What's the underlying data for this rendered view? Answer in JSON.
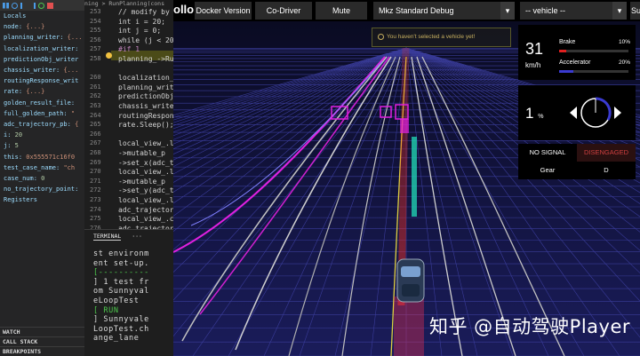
{
  "editor": {
    "tab_title": "ning > RunPlanning(cons",
    "lines": [
      {
        "num": "253",
        "text": "// modify by ...",
        "kw": false
      },
      {
        "num": "254",
        "text": "int i = 20;",
        "kw": false
      },
      {
        "num": "255",
        "text": "int j = 0;",
        "kw": false
      },
      {
        "num": "256",
        "text": "while (j < 20000)",
        "kw": false
      },
      {
        "num": "257",
        "text": "#if 1",
        "kw": true
      },
      {
        "num": "258",
        "text": "planning_->Run",
        "kw": false
      },
      {
        "num": "",
        "text": "",
        "kw": false
      },
      {
        "num": "260",
        "text": "localization_wri",
        "kw": false
      },
      {
        "num": "261",
        "text": "planning_writ",
        "kw": false
      },
      {
        "num": "262",
        "text": "predictionObj_w",
        "kw": false
      },
      {
        "num": "263",
        "text": "chassis_writer-",
        "kw": false
      },
      {
        "num": "264",
        "text": "routingRespons",
        "kw": false
      },
      {
        "num": "265",
        "text": "rate.Sleep();",
        "kw": false
      },
      {
        "num": "266",
        "text": "",
        "kw": false
      },
      {
        "num": "267",
        "text": "local_view_.loc",
        "kw": false
      },
      {
        "num": "268",
        "text": "  ->mutable_p",
        "kw": false
      },
      {
        "num": "269",
        "text": "  ->set_x(adc_t",
        "kw": false
      },
      {
        "num": "270",
        "text": "local_view_.loc",
        "kw": false
      },
      {
        "num": "271",
        "text": "  ->mutable_p",
        "kw": false
      },
      {
        "num": "272",
        "text": "  ->set_y(adc_t",
        "kw": false
      },
      {
        "num": "273",
        "text": "local_view_.loc",
        "kw": false
      },
      {
        "num": "274",
        "text": "  adc_trajector",
        "kw": false
      },
      {
        "num": "275",
        "text": "local_view_.cha",
        "kw": false
      },
      {
        "num": "276",
        "text": "  adc_trajector",
        "kw": false
      }
    ]
  },
  "debug": {
    "variables": [
      {
        "key": "Locals",
        "val": ""
      },
      {
        "key": "node:",
        "val": "{...}"
      },
      {
        "key": "planning_writer:",
        "val": "{..."
      },
      {
        "key": "localization_writer:",
        "val": ""
      },
      {
        "key": "predictionObj_writer",
        "val": ""
      },
      {
        "key": "chassis_writer:",
        "val": "{..."
      },
      {
        "key": "routingResponse_writ",
        "val": ""
      },
      {
        "key": "rate:",
        "val": "{...}"
      },
      {
        "key": "golden_result_file:",
        "val": ""
      },
      {
        "key": "full_golden_path:",
        "val": "\""
      },
      {
        "key": "adc_trajectory_pb:",
        "val": "{"
      },
      {
        "key": "i:",
        "val": "20"
      },
      {
        "key": "j:",
        "val": "5"
      },
      {
        "key": "this:",
        "val": "0x555571c16f0"
      },
      {
        "key": "test_case_name:",
        "val": "\"ch"
      },
      {
        "key": "case_num:",
        "val": "0"
      },
      {
        "key": "no_trajectory_point:",
        "val": ""
      },
      {
        "key": "Registers",
        "val": ""
      }
    ],
    "sections": [
      "WATCH",
      "CALL STACK",
      "BREAKPOINTS"
    ]
  },
  "terminal": {
    "tab_label": "TERMINAL",
    "more": "···",
    "lines": [
      {
        "t": "st environm",
        "g": false
      },
      {
        "t": "ent set-up.",
        "g": false
      },
      {
        "t": "[----------",
        "g": true
      },
      {
        "t": "] 1 test fr",
        "g": false
      },
      {
        "t": "om Sunnyval",
        "g": false
      },
      {
        "t": "eLoopTest",
        "g": false
      },
      {
        "t": "[ RUN",
        "g": true
      },
      {
        "t": "] Sunnyvale",
        "g": false
      },
      {
        "t": "LoopTest.ch",
        "g": false
      },
      {
        "t": "ange_lane",
        "g": false
      }
    ]
  },
  "dreamview": {
    "logo": "ollo",
    "docker_btn": "Docker Version",
    "codriver_btn": "Co-Driver",
    "mute_btn": "Mute",
    "mode_select": "Mkz Standard Debug",
    "vehicle_select": "-- vehicle --",
    "map_select": "Su",
    "notice": "You haven't selected a vehicle yet!",
    "speed": "31",
    "speed_unit": "km/h",
    "brake_label": "Brake",
    "brake_pct": "10%",
    "brake_level": 0.1,
    "accel_label": "Accelerator",
    "accel_pct": "20%",
    "accel_level": 0.2,
    "steer_value": "1",
    "steer_unit": "%",
    "signal": "NO SIGNAL",
    "drive_status": "DISENGAGED",
    "gear_label": "Gear",
    "gear_value": "D",
    "colors": {
      "brake": "#e02020",
      "accel": "#3a3ad0",
      "disengaged": "#d04040",
      "path": "#ff3020"
    },
    "watermark": "知乎 @自动驾驶Player"
  }
}
